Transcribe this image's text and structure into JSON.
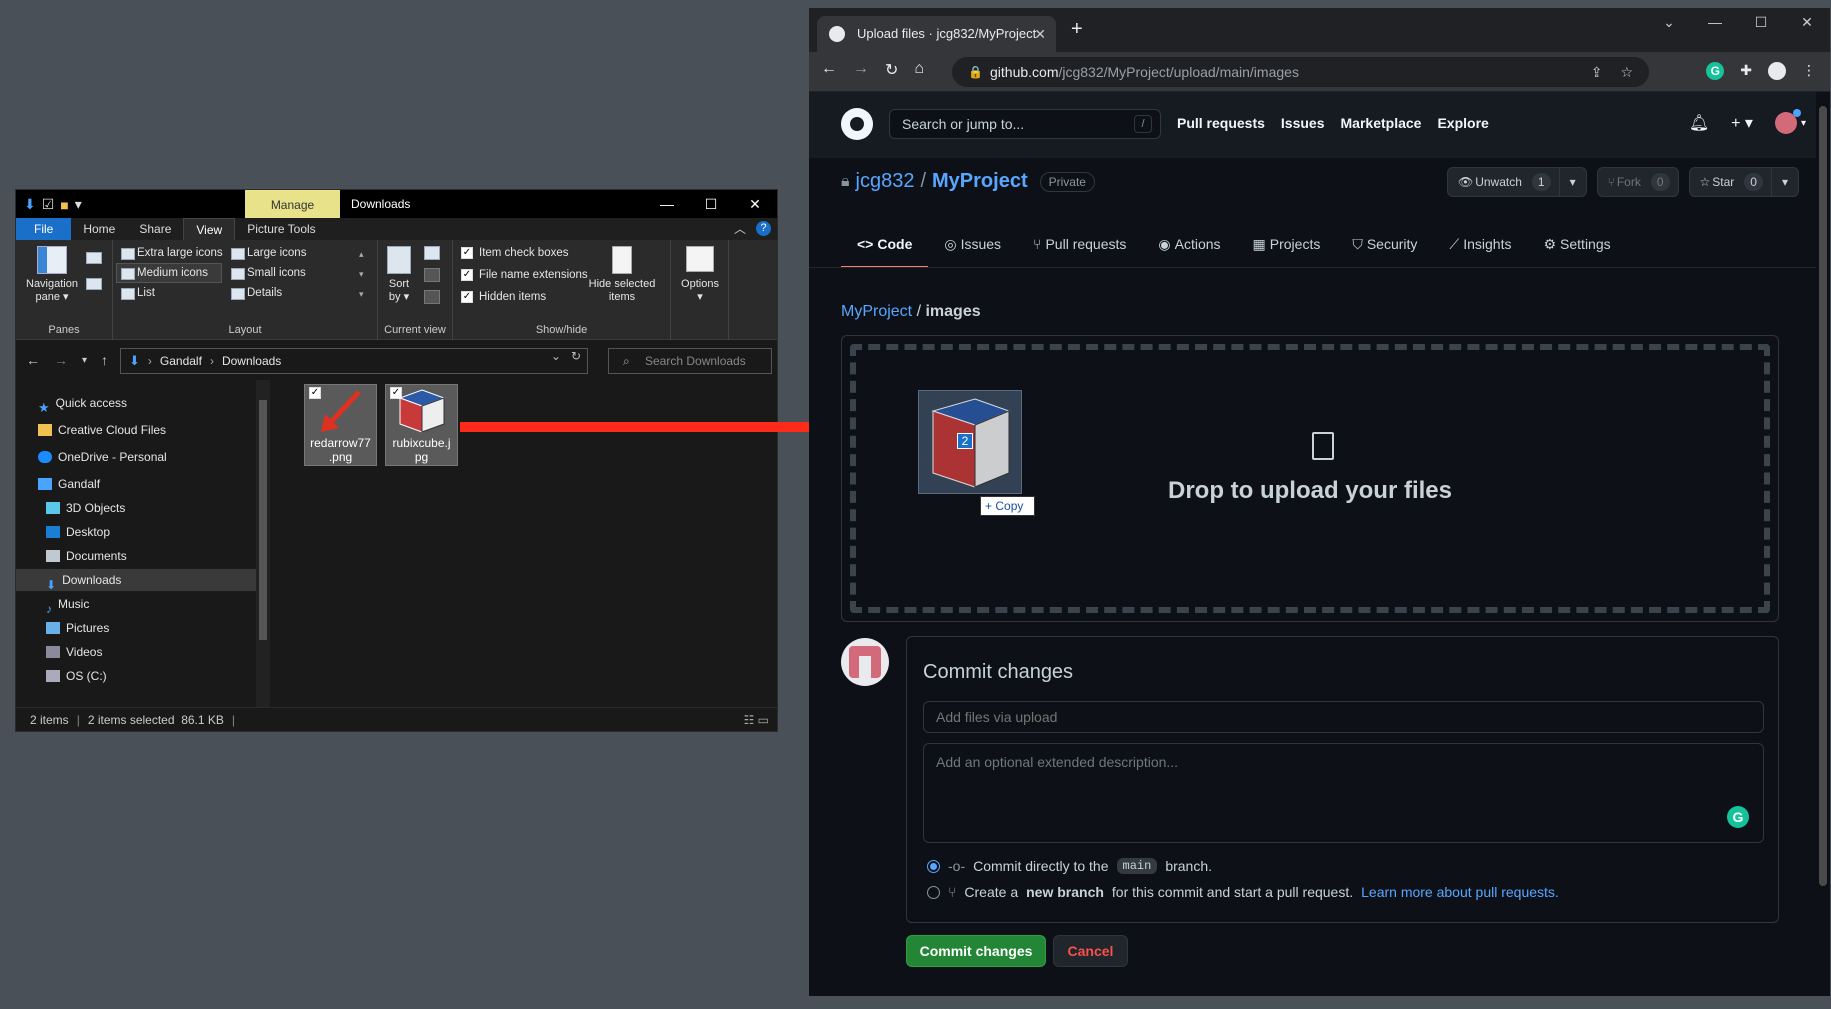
{
  "explorer": {
    "manage_tab": "Manage",
    "title": "Downloads",
    "ribbon_tabs": [
      "File",
      "Home",
      "Share",
      "View",
      "Picture Tools"
    ],
    "panes": {
      "nav_pane_label_1": "Navigation",
      "nav_pane_label_2": "pane",
      "group": "Panes"
    },
    "layout": {
      "items": [
        "Extra large icons",
        "Large icons",
        "Medium icons",
        "Small icons",
        "List",
        "Details"
      ],
      "selected": "Medium icons",
      "group": "Layout"
    },
    "current_view": {
      "sort_label_1": "Sort",
      "sort_label_2": "by",
      "group": "Current view"
    },
    "show_hide": {
      "checkboxes": [
        "Item check boxes",
        "File name extensions",
        "Hidden items"
      ],
      "hide_selected_1": "Hide selected",
      "hide_selected_2": "items",
      "group": "Show/hide"
    },
    "options": "Options",
    "address": {
      "root": "Gandalf",
      "folder": "Downloads"
    },
    "search_placeholder": "Search Downloads",
    "nav_items": [
      "Quick access",
      "Creative Cloud Files",
      "OneDrive - Personal",
      "Gandalf",
      "3D Objects",
      "Desktop",
      "Documents",
      "Downloads",
      "Music",
      "Pictures",
      "Videos",
      "OS (C:)"
    ],
    "files": [
      {
        "name_1": "redarrow77",
        "name_2": ".png"
      },
      {
        "name_1": "rubixcube.j",
        "name_2": "pg"
      }
    ],
    "status": {
      "count": "2 items",
      "selected": "2 items selected",
      "size": "86.1 KB"
    }
  },
  "browser": {
    "tab_title": "Upload files · jcg832/MyProject",
    "url_host": "github.com",
    "url_path": "/jcg832/MyProject/upload/main/images",
    "grammarly": "G"
  },
  "github": {
    "search_placeholder": "Search or jump to...",
    "search_key": "/",
    "topnav": [
      "Pull requests",
      "Issues",
      "Marketplace",
      "Explore"
    ],
    "owner": "jcg832",
    "repo": "MyProject",
    "visibility": "Private",
    "unwatch": {
      "label": "Unwatch",
      "count": "1"
    },
    "fork": {
      "label": "Fork",
      "count": "0"
    },
    "star": {
      "label": "Star",
      "count": "0"
    },
    "repo_tabs": [
      "Code",
      "Issues",
      "Pull requests",
      "Actions",
      "Projects",
      "Security",
      "Insights",
      "Settings"
    ],
    "breadcrumb": {
      "repo": "MyProject",
      "sep": "/",
      "folder": "images"
    },
    "drop_text": "Drop to upload your files",
    "drag_count": "2",
    "copy_tip": "Copy",
    "commit": {
      "title": "Commit changes",
      "summary_placeholder": "Add files via upload",
      "description_placeholder": "Add an optional extended description...",
      "option_direct_pre": "Commit directly to the",
      "branch": "main",
      "option_direct_post": "branch.",
      "option_new_pre": "Create a",
      "option_new_bold": "new branch",
      "option_new_post": "for this commit and start a pull request.",
      "learn_more": "Learn more about pull requests.",
      "submit": "Commit changes",
      "cancel": "Cancel"
    }
  }
}
